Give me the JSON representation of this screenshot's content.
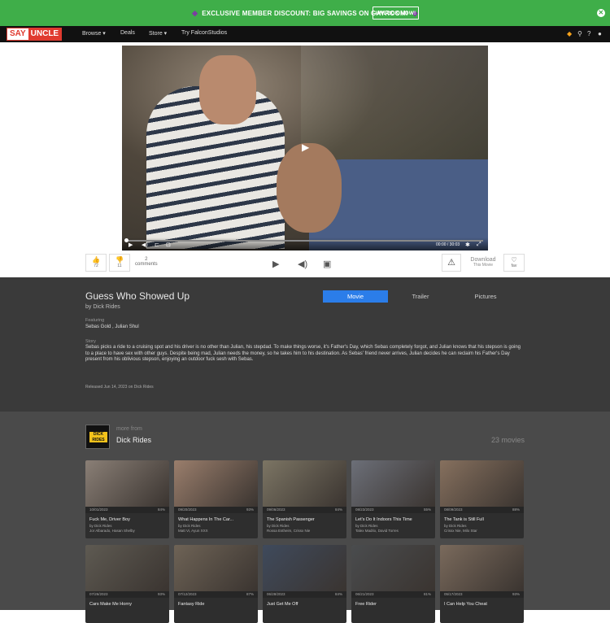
{
  "banner": {
    "text": "EXCLUSIVE MEMBER DISCOUNT: BIG SAVINGS ON GAYROOM!",
    "button": "UNLOCK NOW!",
    "close": "✕"
  },
  "nav": {
    "logo_left": "SAY",
    "logo_right": "UNCLE",
    "items": [
      "Browse ▾",
      "Deals",
      "Store ▾",
      "Try FalconStudios"
    ]
  },
  "player": {
    "time": "00:00 / 30:03"
  },
  "actions": {
    "likes": "72",
    "dislikes": "11",
    "comments_count": "2",
    "comments_label": "comments",
    "download_label": "Download",
    "download_sub": "This Movie",
    "fav_label": "fav"
  },
  "movie": {
    "title": "Guess Who Showed Up",
    "by": "by Dick Rides",
    "tabs": [
      "Movie",
      "Trailer",
      "Pictures"
    ],
    "featuring_label": "Featuring",
    "featuring": "Sebas Gold , Julian Shul",
    "story_label": "Story",
    "story": "Sebas picks a ride to a cruising spot and his driver is no other than Julian, his stepdad. To make things worse, it's Father's Day, which Sebas completely forgot, and Julian knows that his stepson is going to a place to have sex with other guys. Despite being mad, Julian needs the money, so he takes him to his destination. As Sebas' friend never arrives, Julian decides he can reclaim his Father's Day present from his oblivious stepson, enjoying an outdoor fuck sesh with Sebas.",
    "released": "Released Jun 14, 2023 on Dick Rides"
  },
  "studio": {
    "logo_text": "DICK RIDES",
    "more_from": "more from",
    "name": "Dick Rides",
    "count": "23 movies"
  },
  "cards": [
    {
      "date": "10/01/2023",
      "rating": "84%",
      "title": "Fuck Me, Driver Boy",
      "by": "by Dick Rides",
      "performers": "Jor Albarado, Hasan Shelby",
      "color": "#8a7f76"
    },
    {
      "date": "09/20/2023",
      "rating": "93%",
      "title": "What Happens In The Car...",
      "by": "by Dick Rides",
      "performers": "Matt Vi, Ayun XXX",
      "color": "#9a7e6c"
    },
    {
      "date": "09/06/2023",
      "rating": "84%",
      "title": "The Spanish Passenger",
      "by": "by Dick Rides",
      "performers": "Rossa Estheim, Crissx Nie",
      "color": "#7c7564"
    },
    {
      "date": "08/23/2023",
      "rating": "55%",
      "title": "Let's Do It Indoors This Time",
      "by": "by Dick Rides",
      "performers": "Talex Madrix, David Torres",
      "color": "#6c6f78"
    },
    {
      "date": "08/09/2023",
      "rating": "88%",
      "title": "The Tank is Still Full",
      "by": "by Dick Rides",
      "performers": "Crissx Nie, Milo Star",
      "color": "#86705e"
    },
    {
      "date": "07/26/2023",
      "rating": "93%",
      "title": "Cars Make Me Horny",
      "by": "",
      "performers": "",
      "color": "#5e5a52"
    },
    {
      "date": "07/12/2023",
      "rating": "87%",
      "title": "Fantasy Ride",
      "by": "",
      "performers": "",
      "color": "#6e6356"
    },
    {
      "date": "06/28/2023",
      "rating": "84%",
      "title": "Just Get Me Off",
      "by": "",
      "performers": "",
      "color": "#3f4a5c"
    },
    {
      "date": "06/21/2023",
      "rating": "81%",
      "title": "Free Rider",
      "by": "",
      "performers": "",
      "color": "#4a4c4e"
    },
    {
      "date": "05/17/2023",
      "rating": "93%",
      "title": "I Can Help You Cheat",
      "by": "",
      "performers": "",
      "color": "#7a6a5c"
    }
  ]
}
